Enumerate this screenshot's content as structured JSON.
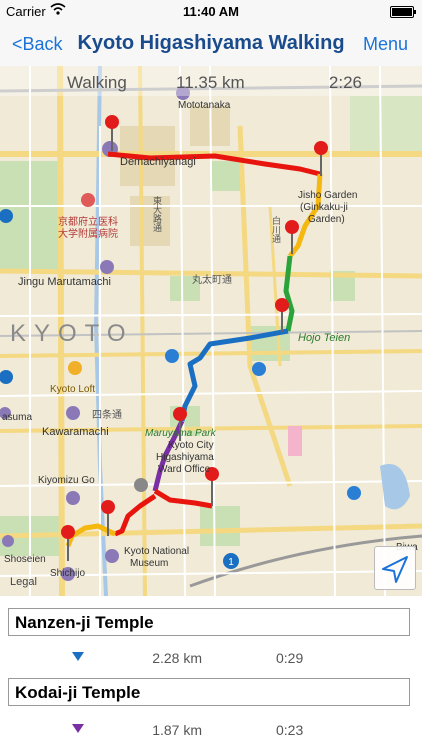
{
  "status_bar": {
    "carrier": "Carrier",
    "time": "11:40 AM"
  },
  "navbar": {
    "back_label": "<Back",
    "title": "Kyoto Higashiyama Walking",
    "menu_label": "Menu"
  },
  "map": {
    "summary": {
      "mode": "Walking",
      "distance": "11.35 km",
      "duration": "2:26"
    },
    "labels": {
      "mototanaka": "Mototanaka",
      "demachiyanagi": "Demachiyanagi",
      "jisho_garden": "Jisho Garden",
      "ginkaku_garden": "(Ginkaku-ji",
      "ginkaku_garden2": "Garden)",
      "kyoto_hospital": "京都府立医科",
      "kyoto_hospital2": "大学附属病院",
      "jingu": "Jingu Marutamachi",
      "kyoto": "KYOTO",
      "hojo_teien": "Hojo Teien",
      "kyoto_loft": "Kyoto Loft",
      "kawaramachi": "Kawaramachi",
      "asuma": "asuma",
      "maruyama": "Maruyama Park",
      "city_office1": "Kyoto City",
      "city_office2": "Higashiyama",
      "city_office3": "Ward Office",
      "kiyomizu": "Kiyomizu Go",
      "shoseien": "Shoseien",
      "museum1": "Kyoto National",
      "museum2": "Museum",
      "shichijo": "Shichijo",
      "legal": "Legal",
      "biwa": "Biwa",
      "marutamachi_road": "丸太町通",
      "shijo_road": "四条通",
      "shirakawa": "白川通",
      "higashioji": "東大路通"
    },
    "route_colors": {
      "red": "#e8150f",
      "yellow": "#f5b80f",
      "green": "#2aa33a",
      "blue": "#1b6fc2",
      "purple": "#7a2fa5"
    }
  },
  "stops": [
    {
      "name": "Nanzen-ji Temple",
      "arrow_color": "#1b6fc2",
      "distance": "2.28 km",
      "time": "0:29"
    },
    {
      "name": "Kodai-ji Temple",
      "arrow_color": "#7a2fa5",
      "distance": "1.87 km",
      "time": "0:23"
    }
  ]
}
